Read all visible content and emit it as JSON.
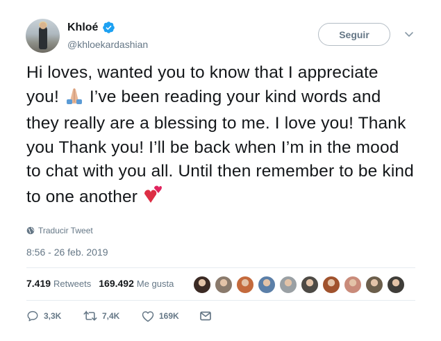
{
  "author": {
    "name": "Khloé",
    "handle": "@khloekardashian"
  },
  "follow": {
    "label": "Seguir"
  },
  "tweet": {
    "text_part1": "Hi loves, wanted you to know that I appreciate you! ",
    "text_part2": " I’ve been reading your kind words and they really are a blessing to me. I love you! Thank you Thank you! I’ll be back when I’m in the mood to chat with you all. Until then remember to be kind to one another ",
    "emoji1": "folded-hands-emoji",
    "emoji2": "two-hearts-emoji"
  },
  "translate_label": "Traducir Tweet",
  "timestamp": "8:56 - 26 feb. 2019",
  "stats": {
    "retweets_count": "7.419",
    "retweets_label": "Retweets",
    "likes_count": "169.492",
    "likes_label": "Me gusta"
  },
  "likers": [
    "#3b2a24",
    "#8a7a6c",
    "#c46a3c",
    "#5b7fa8",
    "#9aa0a4",
    "#4d4a45",
    "#a0522d",
    "#c98b7a",
    "#6b5e4b",
    "#3f3d39"
  ],
  "actions": {
    "replies": "3,3K",
    "retweets": "7,4K",
    "likes": "169K"
  },
  "colors": {
    "verified": "#1da1f2",
    "secondary_text": "#657786",
    "heart": "#e0245e"
  }
}
